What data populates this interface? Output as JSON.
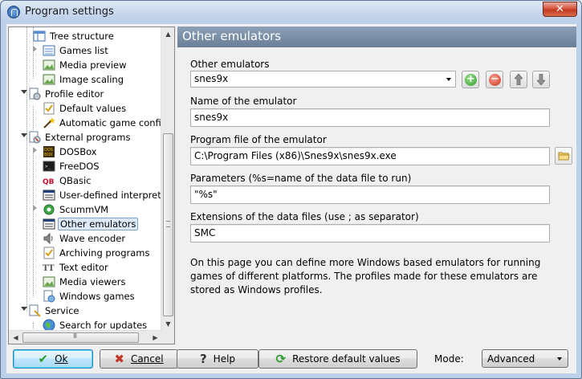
{
  "window": {
    "title": "Program settings",
    "close_symbol": "✕"
  },
  "tree": {
    "items": [
      {
        "label": "Tree structure",
        "icon": "tree-structure-icon",
        "level": 2
      },
      {
        "label": "Games list",
        "icon": "games-list-icon",
        "level": 2,
        "collapsed": true
      },
      {
        "label": "Media preview",
        "icon": "media-preview-icon",
        "level": 2
      },
      {
        "label": "Image scaling",
        "icon": "image-scaling-icon",
        "level": 2
      },
      {
        "label": "Profile editor",
        "icon": "profile-editor-icon",
        "level": 1,
        "expanded": true
      },
      {
        "label": "Default values",
        "icon": "default-values-icon",
        "level": 2
      },
      {
        "label": "Automatic game config",
        "icon": "magic-wand-icon",
        "level": 2
      },
      {
        "label": "External programs",
        "icon": "external-programs-icon",
        "level": 1,
        "expanded": true
      },
      {
        "label": "DOSBox",
        "icon": "dosbox-icon",
        "level": 2,
        "collapsed": true
      },
      {
        "label": "FreeDOS",
        "icon": "freedos-icon",
        "level": 2
      },
      {
        "label": "QBasic",
        "icon": "qbasic-icon",
        "level": 2
      },
      {
        "label": "User-defined interpreter",
        "icon": "interpreter-icon",
        "level": 2
      },
      {
        "label": "ScummVM",
        "icon": "scummvm-icon",
        "level": 2,
        "collapsed": true
      },
      {
        "label": "Other emulators",
        "icon": "other-emulators-icon",
        "level": 2,
        "selected": true
      },
      {
        "label": "Wave encoder",
        "icon": "speaker-icon",
        "level": 2
      },
      {
        "label": "Archiving programs",
        "icon": "archive-icon",
        "level": 2
      },
      {
        "label": "Text editor",
        "icon": "text-editor-icon",
        "level": 2
      },
      {
        "label": "Media viewers",
        "icon": "media-viewers-icon",
        "level": 2
      },
      {
        "label": "Windows games",
        "icon": "windows-games-icon",
        "level": 2
      },
      {
        "label": "Service",
        "icon": "service-icon",
        "level": 1,
        "expanded": true
      },
      {
        "label": "Search for updates",
        "icon": "globe-icon",
        "level": 2
      }
    ]
  },
  "panel": {
    "header": "Other emulators",
    "emulators_label": "Other emulators",
    "emulators_selected": "snes9x",
    "name_label": "Name of the emulator",
    "name_value": "snes9x",
    "program_label": "Program file of the emulator",
    "program_value": "C:\\Program Files (x86)\\Snes9x\\snes9x.exe",
    "params_label": "Parameters (%s=name of the data file to run)",
    "params_value": "\"%s\"",
    "ext_label": "Extensions of the data files (use ; as separator)",
    "ext_value": "SMC",
    "description": "On this page you can define more Windows based emulators for running games of different platforms. The profiles made for these emulators are stored as Windows profiles."
  },
  "buttons": {
    "ok": "Ok",
    "cancel": "Cancel",
    "help": "Help",
    "restore": "Restore default values",
    "mode_label": "Mode:",
    "mode_value": "Advanced"
  },
  "colors": {
    "header_bg": "#7a8ea6",
    "selected_bg": "#dde9f7",
    "accent": "#3c7fb1"
  }
}
